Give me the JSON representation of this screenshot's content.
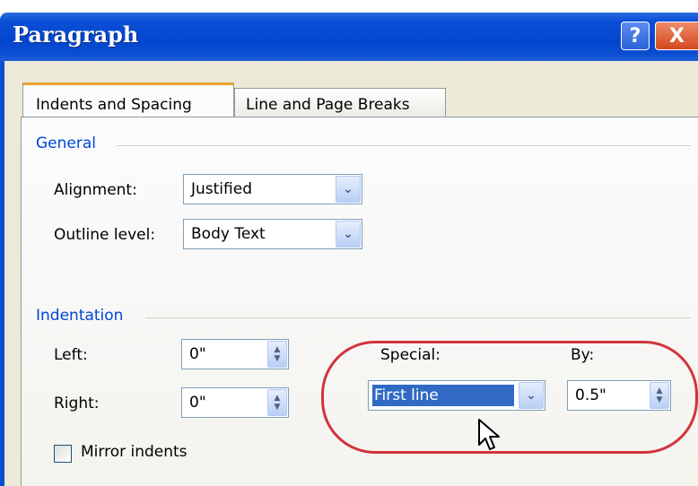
{
  "window": {
    "title": "Paragraph",
    "help_glyph": "?",
    "close_glyph": "X"
  },
  "tabs": [
    {
      "label": "Indents and Spacing",
      "active": true
    },
    {
      "label": "Line and Page Breaks",
      "active": false
    }
  ],
  "general": {
    "heading": "General",
    "alignment_label": "Alignment:",
    "alignment_value": "Justified",
    "outline_label": "Outline level:",
    "outline_value": "Body Text"
  },
  "indentation": {
    "heading": "Indentation",
    "left_label": "Left:",
    "left_value": "0\"",
    "right_label": "Right:",
    "right_value": "0\"",
    "special_label": "Special:",
    "special_value": "First line",
    "by_label": "By:",
    "by_value": "0.5\"",
    "mirror_label": "Mirror indents",
    "mirror_checked": false
  },
  "icons": {
    "dropdown": "chevron-down-icon",
    "spinner": "spin-up-down-icon",
    "cursor": "mouse-pointer-icon"
  },
  "colors": {
    "titlebar": "#0346cf",
    "group_heading": "#0046d5",
    "selection": "#316ac5",
    "highlight_ring": "#d0343c",
    "active_tab_accent": "#e7a02f"
  }
}
